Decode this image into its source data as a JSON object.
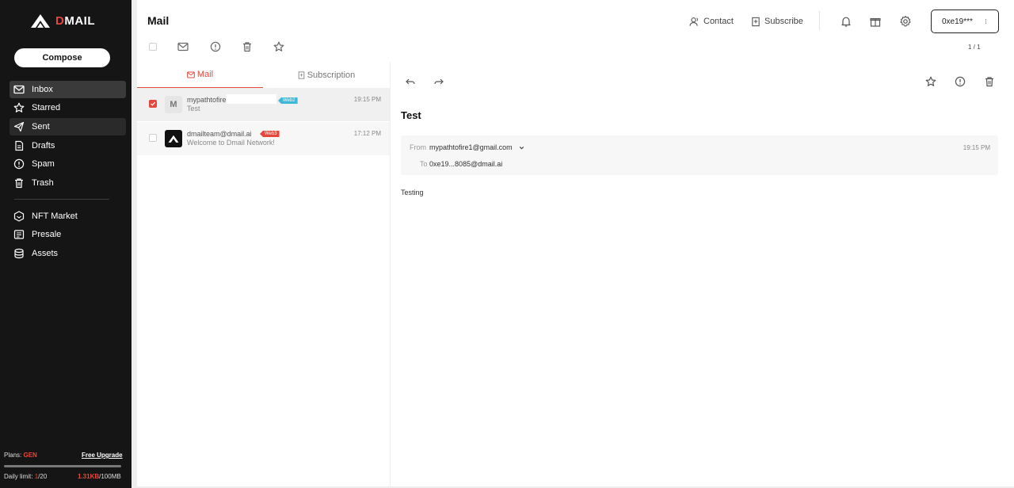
{
  "app": {
    "logo_text_d": "D",
    "logo_text_rest": "MAIL"
  },
  "sidebar": {
    "compose": "Compose",
    "items": [
      {
        "label": "Inbox",
        "icon": "inbox-icon"
      },
      {
        "label": "Starred",
        "icon": "star-icon"
      },
      {
        "label": "Sent",
        "icon": "send-icon"
      },
      {
        "label": "Drafts",
        "icon": "drafts-icon"
      },
      {
        "label": "Spam",
        "icon": "spam-icon"
      },
      {
        "label": "Trash",
        "icon": "trash-icon"
      },
      {
        "label": "NFT Market",
        "icon": "nft-icon"
      },
      {
        "label": "Presale",
        "icon": "presale-icon"
      },
      {
        "label": "Assets",
        "icon": "assets-icon"
      }
    ],
    "plans_label": "Plans:",
    "plan_name": "GEN",
    "upgrade": "Free Upgrade",
    "daily_label": "Daily limit:",
    "daily_used": "1",
    "daily_total": "/20",
    "storage_used": "1.31KB",
    "storage_total": "/100MB"
  },
  "header": {
    "title": "Mail",
    "contact": "Contact",
    "subscribe": "Subscribe",
    "account": "0xe19***",
    "account_more": "⁝",
    "pager": "1 / 1"
  },
  "list": {
    "tab_mail": "Mail",
    "tab_subscription": "Subscription",
    "rows": [
      {
        "avatar": "M",
        "from": "mypathtofire",
        "tag": "Web2",
        "subject": "Test",
        "time": "19:15 PM",
        "checked": true
      },
      {
        "avatar": "DMAIL",
        "from": "dmailteam@dmail.ai",
        "tag": "Web3",
        "subject": "Welcome to Dmail Network!",
        "time": "17:12 PM",
        "checked": false
      }
    ]
  },
  "reader": {
    "subject": "Test",
    "from_label": "From",
    "from": "mypathtofire1@gmail.com",
    "to_label": "To",
    "to": "0xe19...8085@dmail.ai",
    "time": "19:15 PM",
    "body": "Testing"
  },
  "colors": {
    "accent": "#e6473c",
    "sidebar_bg": "#151515",
    "web2_tag": "#3fb7d6"
  }
}
